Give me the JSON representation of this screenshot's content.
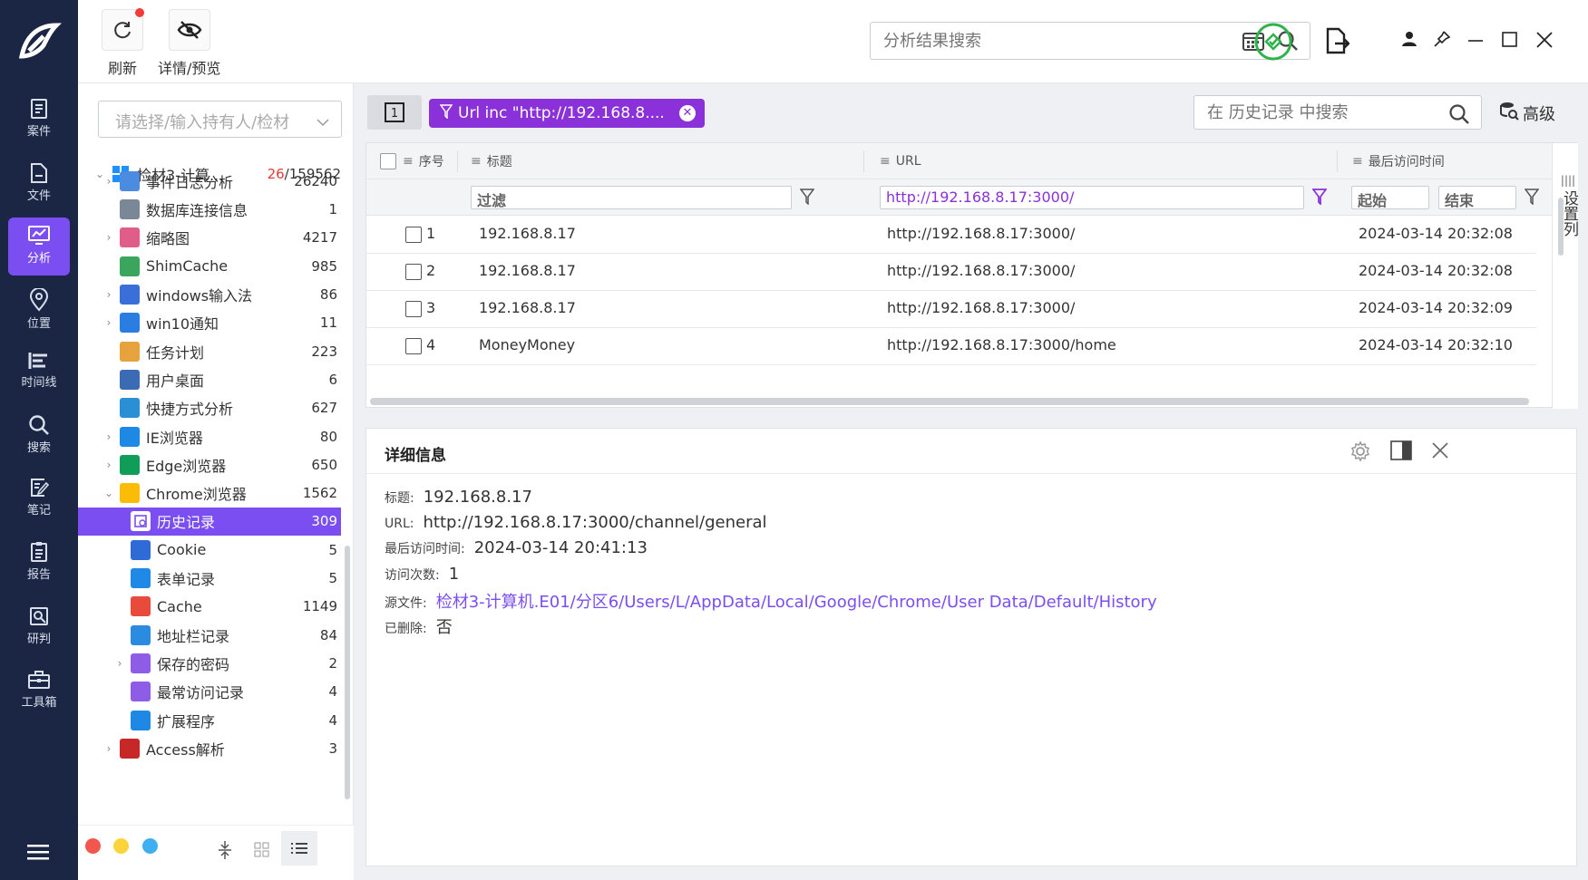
{
  "rail": {
    "items": [
      {
        "label": "案件",
        "icon": "case-icon"
      },
      {
        "label": "文件",
        "icon": "file-icon"
      },
      {
        "label": "分析",
        "icon": "analysis-icon"
      },
      {
        "label": "位置",
        "icon": "location-icon"
      },
      {
        "label": "时间线",
        "icon": "timeline-icon"
      },
      {
        "label": "搜索",
        "icon": "search-icon"
      },
      {
        "label": "笔记",
        "icon": "note-icon"
      },
      {
        "label": "报告",
        "icon": "report-icon"
      },
      {
        "label": "研判",
        "icon": "judge-icon"
      },
      {
        "label": "工具箱",
        "icon": "toolbox-icon"
      }
    ],
    "active_index": 2
  },
  "toolbar": {
    "refresh_label": "刷新",
    "preview_label": "详情/预览",
    "search_placeholder": "分析结果搜索"
  },
  "tree": {
    "owner_placeholder": "请选择/输入持有人/检材",
    "root_label": "检材3-计算...",
    "root_count_red": "26",
    "root_count_total": "/159562",
    "items": [
      {
        "label": "事件日志分析",
        "count": "26240",
        "indent": 1,
        "arrow": "›"
      },
      {
        "label": "数据库连接信息",
        "count": "1",
        "indent": 1,
        "arrow": ""
      },
      {
        "label": "缩略图",
        "count": "4217",
        "indent": 1,
        "arrow": "›"
      },
      {
        "label": "ShimCache",
        "count": "985",
        "indent": 1,
        "arrow": ""
      },
      {
        "label": "windows输入法",
        "count": "86",
        "indent": 1,
        "arrow": "›"
      },
      {
        "label": "win10通知",
        "count": "11",
        "indent": 1,
        "arrow": "›"
      },
      {
        "label": "任务计划",
        "count": "223",
        "indent": 1,
        "arrow": ""
      },
      {
        "label": "用户桌面",
        "count": "6",
        "indent": 1,
        "arrow": ""
      },
      {
        "label": "快捷方式分析",
        "count": "627",
        "indent": 1,
        "arrow": ""
      },
      {
        "label": "IE浏览器",
        "count": "80",
        "indent": 1,
        "arrow": "›"
      },
      {
        "label": "Edge浏览器",
        "count": "650",
        "indent": 1,
        "arrow": "›"
      },
      {
        "label": "Chrome浏览器",
        "count": "1562",
        "indent": 1,
        "arrow": "⌄"
      },
      {
        "label": "历史记录",
        "count": "309",
        "indent": 2,
        "arrow": "",
        "selected": true
      },
      {
        "label": "Cookie",
        "count": "5",
        "indent": 2,
        "arrow": ""
      },
      {
        "label": "表单记录",
        "count": "5",
        "indent": 2,
        "arrow": ""
      },
      {
        "label": "Cache",
        "count": "1149",
        "indent": 2,
        "arrow": ""
      },
      {
        "label": "地址栏记录",
        "count": "84",
        "indent": 2,
        "arrow": ""
      },
      {
        "label": "保存的密码",
        "count": "2",
        "indent": 2,
        "arrow": "›"
      },
      {
        "label": "最常访问记录",
        "count": "4",
        "indent": 2,
        "arrow": ""
      },
      {
        "label": "扩展程序",
        "count": "4",
        "indent": 2,
        "arrow": ""
      },
      {
        "label": "Access解析",
        "count": "3",
        "indent": 1,
        "arrow": "›"
      }
    ]
  },
  "filterbar": {
    "page_btn": "1",
    "chip_label": "Url inc \"http://192.168.8....",
    "search_placeholder": "在 历史记录 中搜索",
    "advanced_label": "高级"
  },
  "grid": {
    "headers": {
      "seq": "序号",
      "title": "标题",
      "url": "URL",
      "last_visit": "最后访问时间"
    },
    "filter_title_placeholder": "过滤",
    "filter_url_value": "http://192.168.8.17:3000/",
    "filter_start": "起始",
    "filter_end": "结束",
    "set_columns": "设置列",
    "rows": [
      {
        "seq": "1",
        "title": "192.168.8.17",
        "url": "http://192.168.8.17:3000/",
        "time": "2024-03-14 20:32:08"
      },
      {
        "seq": "2",
        "title": "192.168.8.17",
        "url": "http://192.168.8.17:3000/",
        "time": "2024-03-14 20:32:08"
      },
      {
        "seq": "3",
        "title": "192.168.8.17",
        "url": "http://192.168.8.17:3000/",
        "time": "2024-03-14 20:32:09"
      },
      {
        "seq": "4",
        "title": "MoneyMoney",
        "url": "http://192.168.8.17:3000/home",
        "time": "2024-03-14 20:32:10"
      }
    ]
  },
  "detail": {
    "title": "详细信息",
    "fields": [
      {
        "label": "标题:",
        "value": "192.168.8.17"
      },
      {
        "label": "URL:",
        "value": "http://192.168.8.17:3000/channel/general"
      },
      {
        "label": "最后访问时间:",
        "value": "2024-03-14 20:41:13"
      },
      {
        "label": "访问次数:",
        "value": "1"
      },
      {
        "label": "源文件:",
        "value": "检材3-计算机.E01/分区6/Users/L/AppData/Local/Google/Chrome/User Data/Default/History",
        "link": true
      },
      {
        "label": "已删除:",
        "value": "否"
      }
    ]
  },
  "colors": {
    "accent": "#7a4ef0",
    "chip": "#8a31d9",
    "rail": "#1a2644",
    "ok_green": "#2fb34a"
  }
}
